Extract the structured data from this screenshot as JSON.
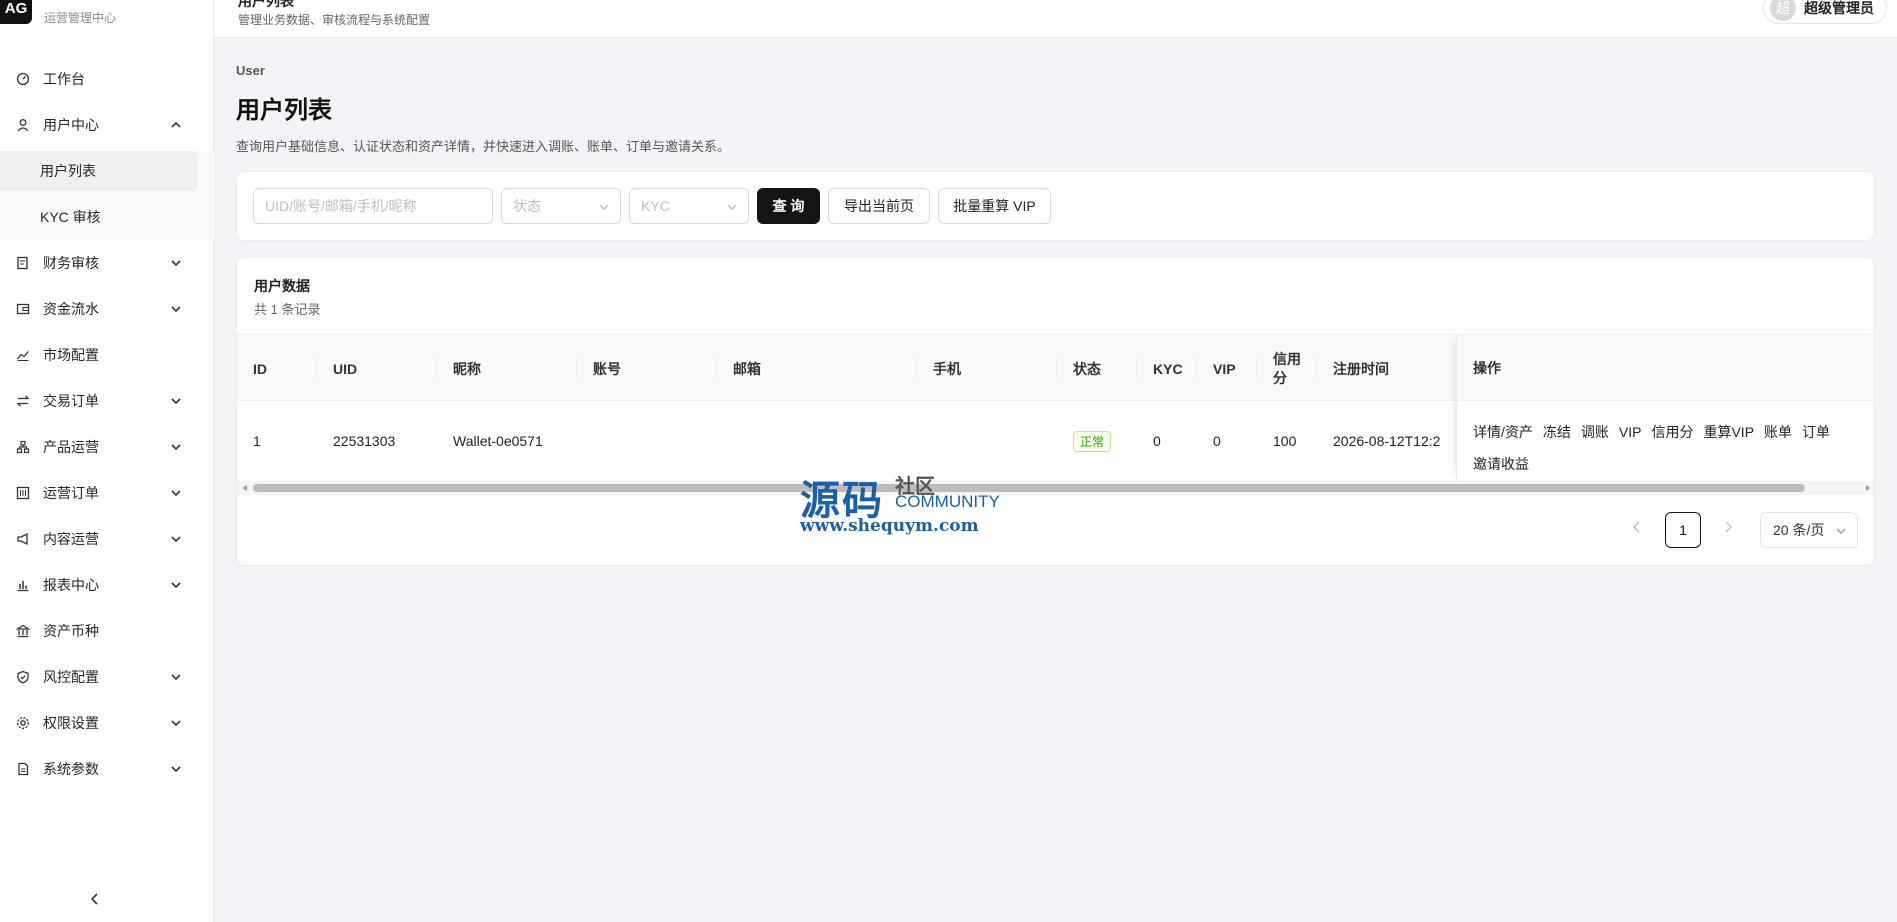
{
  "brand": {
    "logo": "AG",
    "subtitle": "运营管理中心"
  },
  "nav": [
    {
      "label": "工作台",
      "icon": "dashboard-icon",
      "expandable": false
    },
    {
      "label": "用户中心",
      "icon": "user-icon",
      "expandable": true,
      "expanded": true
    },
    {
      "label": "财务审核",
      "icon": "audit-icon",
      "expandable": true
    },
    {
      "label": "资金流水",
      "icon": "wallet-icon",
      "expandable": true
    },
    {
      "label": "市场配置",
      "icon": "chart-line-icon",
      "expandable": false
    },
    {
      "label": "交易订单",
      "icon": "swap-icon",
      "expandable": true
    },
    {
      "label": "产品运营",
      "icon": "cluster-icon",
      "expandable": true
    },
    {
      "label": "运营订单",
      "icon": "order-icon",
      "expandable": true
    },
    {
      "label": "内容运营",
      "icon": "megaphone-icon",
      "expandable": true
    },
    {
      "label": "报表中心",
      "icon": "bar-chart-icon",
      "expandable": true
    },
    {
      "label": "资产币种",
      "icon": "bank-icon",
      "expandable": false
    },
    {
      "label": "风控配置",
      "icon": "shield-icon",
      "expandable": true
    },
    {
      "label": "权限设置",
      "icon": "gear-icon",
      "expandable": true
    },
    {
      "label": "系统参数",
      "icon": "file-icon",
      "expandable": true
    }
  ],
  "nav_sub": {
    "user_list": "用户列表",
    "kyc": "KYC 审核"
  },
  "header": {
    "sub": "管理业务数据、审核流程与系统配置",
    "avatar": "超",
    "user": "超级管理员"
  },
  "page": {
    "crumb": "User",
    "title": "用户列表",
    "desc": "查询用户基础信息、认证状态和资产详情，并快速进入调账、账单、订单与邀请关系。"
  },
  "filters": {
    "search_placeholder": "UID/账号/邮箱/手机/昵称",
    "status_placeholder": "状态",
    "kyc_placeholder": "KYC",
    "query": "查 询",
    "export": "导出当前页",
    "recalc_vip": "批量重算 VIP"
  },
  "table": {
    "title": "用户数据",
    "count": "共 1 条记录",
    "columns": {
      "id": "ID",
      "uid": "UID",
      "nick": "昵称",
      "account": "账号",
      "email": "邮箱",
      "phone": "手机",
      "status": "状态",
      "kyc": "KYC",
      "vip": "VIP",
      "credit": "信用分",
      "reg": "注册时间",
      "ops": "操作"
    },
    "rows": [
      {
        "id": "1",
        "uid": "22531303",
        "nick": "Wallet-0e0571",
        "account": "",
        "email": "",
        "phone": "",
        "status": "正常",
        "kyc": "0",
        "vip": "0",
        "credit": "100",
        "reg": "2026-08-12T12:2"
      }
    ],
    "ops": [
      "详情/资产",
      "冻结",
      "调账",
      "VIP",
      "信用分",
      "重算VIP",
      "账单",
      "订单",
      "邀请收益"
    ]
  },
  "pager": {
    "page": "1",
    "size": "20 条/页"
  },
  "watermark": {
    "main": "源码",
    "side1": "社区",
    "side2": "COMMUNITY",
    "url": "www.shequym.com"
  }
}
